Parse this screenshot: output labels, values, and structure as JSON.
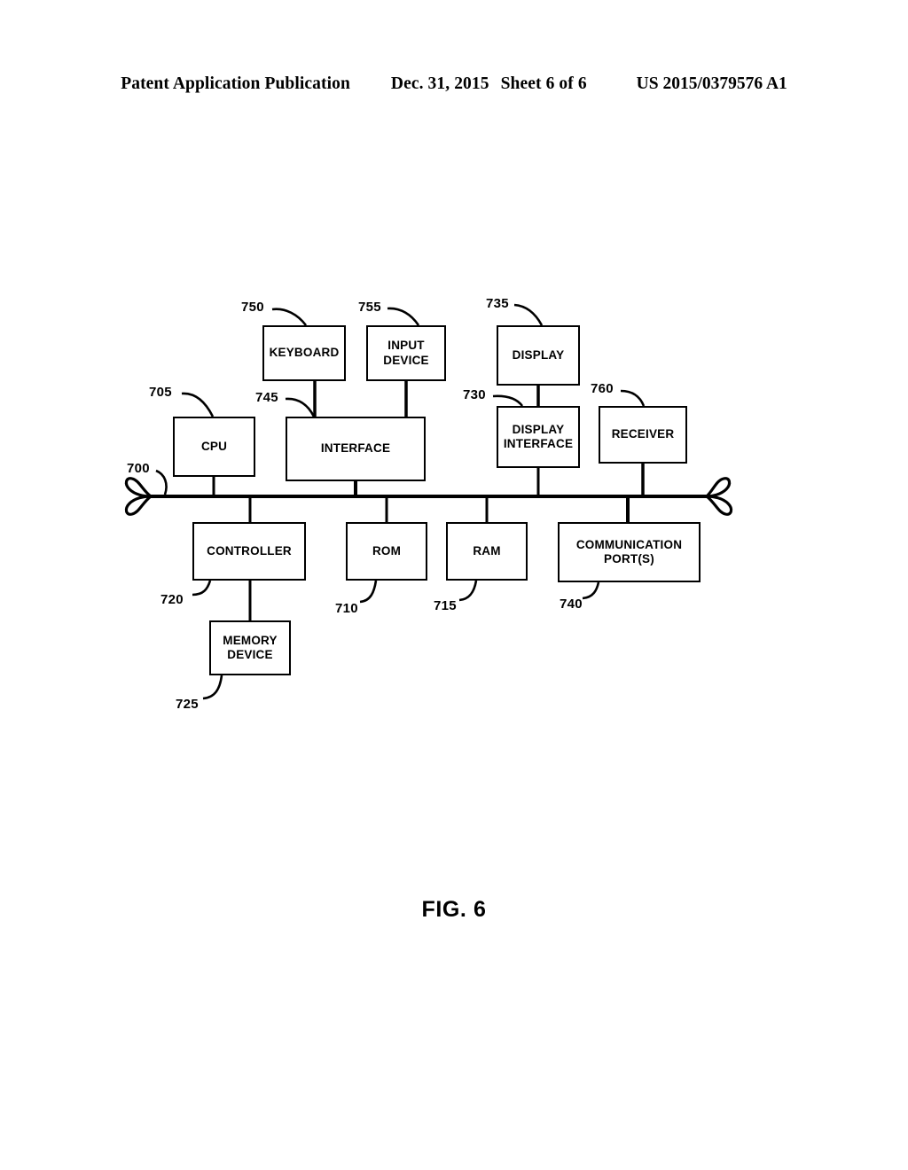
{
  "header": {
    "publication": "Patent Application Publication",
    "date": "Dec. 31, 2015",
    "sheet": "Sheet 6 of 6",
    "number": "US 2015/0379576 A1"
  },
  "figure": {
    "caption": "FIG. 6",
    "line_color": "#000000",
    "background_color": "#ffffff"
  },
  "diagram": {
    "type": "block-diagram",
    "blocks": [
      {
        "id": "keyboard",
        "label": "KEYBOARD",
        "ref": "750"
      },
      {
        "id": "input-device",
        "label": "INPUT\nDEVICE",
        "ref": "755"
      },
      {
        "id": "display",
        "label": "DISPLAY",
        "ref": "735"
      },
      {
        "id": "cpu",
        "label": "CPU",
        "ref": "705"
      },
      {
        "id": "interface",
        "label": "INTERFACE",
        "ref": "745"
      },
      {
        "id": "display-interface",
        "label": "DISPLAY\nINTERFACE",
        "ref": "730"
      },
      {
        "id": "receiver",
        "label": "RECEIVER",
        "ref": "760"
      },
      {
        "id": "controller",
        "label": "CONTROLLER",
        "ref": "720"
      },
      {
        "id": "rom",
        "label": "ROM",
        "ref": "710"
      },
      {
        "id": "ram",
        "label": "RAM",
        "ref": "715"
      },
      {
        "id": "communication-ports",
        "label": "COMMUNICATION\nPORT(S)",
        "ref": "740"
      },
      {
        "id": "memory-device",
        "label": "MEMORY\nDEVICE",
        "ref": "725"
      }
    ],
    "bus": {
      "id": "system-bus",
      "ref": "700"
    },
    "block_labels": {
      "keyboard": "KEYBOARD",
      "input_device_line1": "INPUT",
      "input_device_line2": "DEVICE",
      "display": "DISPLAY",
      "cpu": "CPU",
      "interface": "INTERFACE",
      "display_interface_line1": "DISPLAY",
      "display_interface_line2": "INTERFACE",
      "receiver": "RECEIVER",
      "controller": "CONTROLLER",
      "rom": "ROM",
      "ram": "RAM",
      "comm_ports_line1": "COMMUNICATION",
      "comm_ports_line2": "PORT(S)",
      "memory_device_line1": "MEMORY",
      "memory_device_line2": "DEVICE"
    },
    "refs": {
      "keyboard": "750",
      "input_device": "755",
      "display": "735",
      "cpu": "705",
      "interface": "745",
      "display_interface": "730",
      "receiver": "760",
      "bus": "700",
      "controller": "720",
      "rom": "710",
      "ram": "715",
      "comm_ports": "740",
      "memory_device": "725"
    },
    "connections": [
      {
        "from": "keyboard",
        "to": "interface"
      },
      {
        "from": "input-device",
        "to": "interface"
      },
      {
        "from": "display",
        "to": "display-interface"
      },
      {
        "from": "cpu",
        "to": "system-bus"
      },
      {
        "from": "interface",
        "to": "system-bus"
      },
      {
        "from": "display-interface",
        "to": "system-bus"
      },
      {
        "from": "receiver",
        "to": "system-bus"
      },
      {
        "from": "system-bus",
        "to": "controller"
      },
      {
        "from": "system-bus",
        "to": "rom"
      },
      {
        "from": "system-bus",
        "to": "ram"
      },
      {
        "from": "system-bus",
        "to": "communication-ports"
      },
      {
        "from": "controller",
        "to": "memory-device"
      }
    ]
  }
}
